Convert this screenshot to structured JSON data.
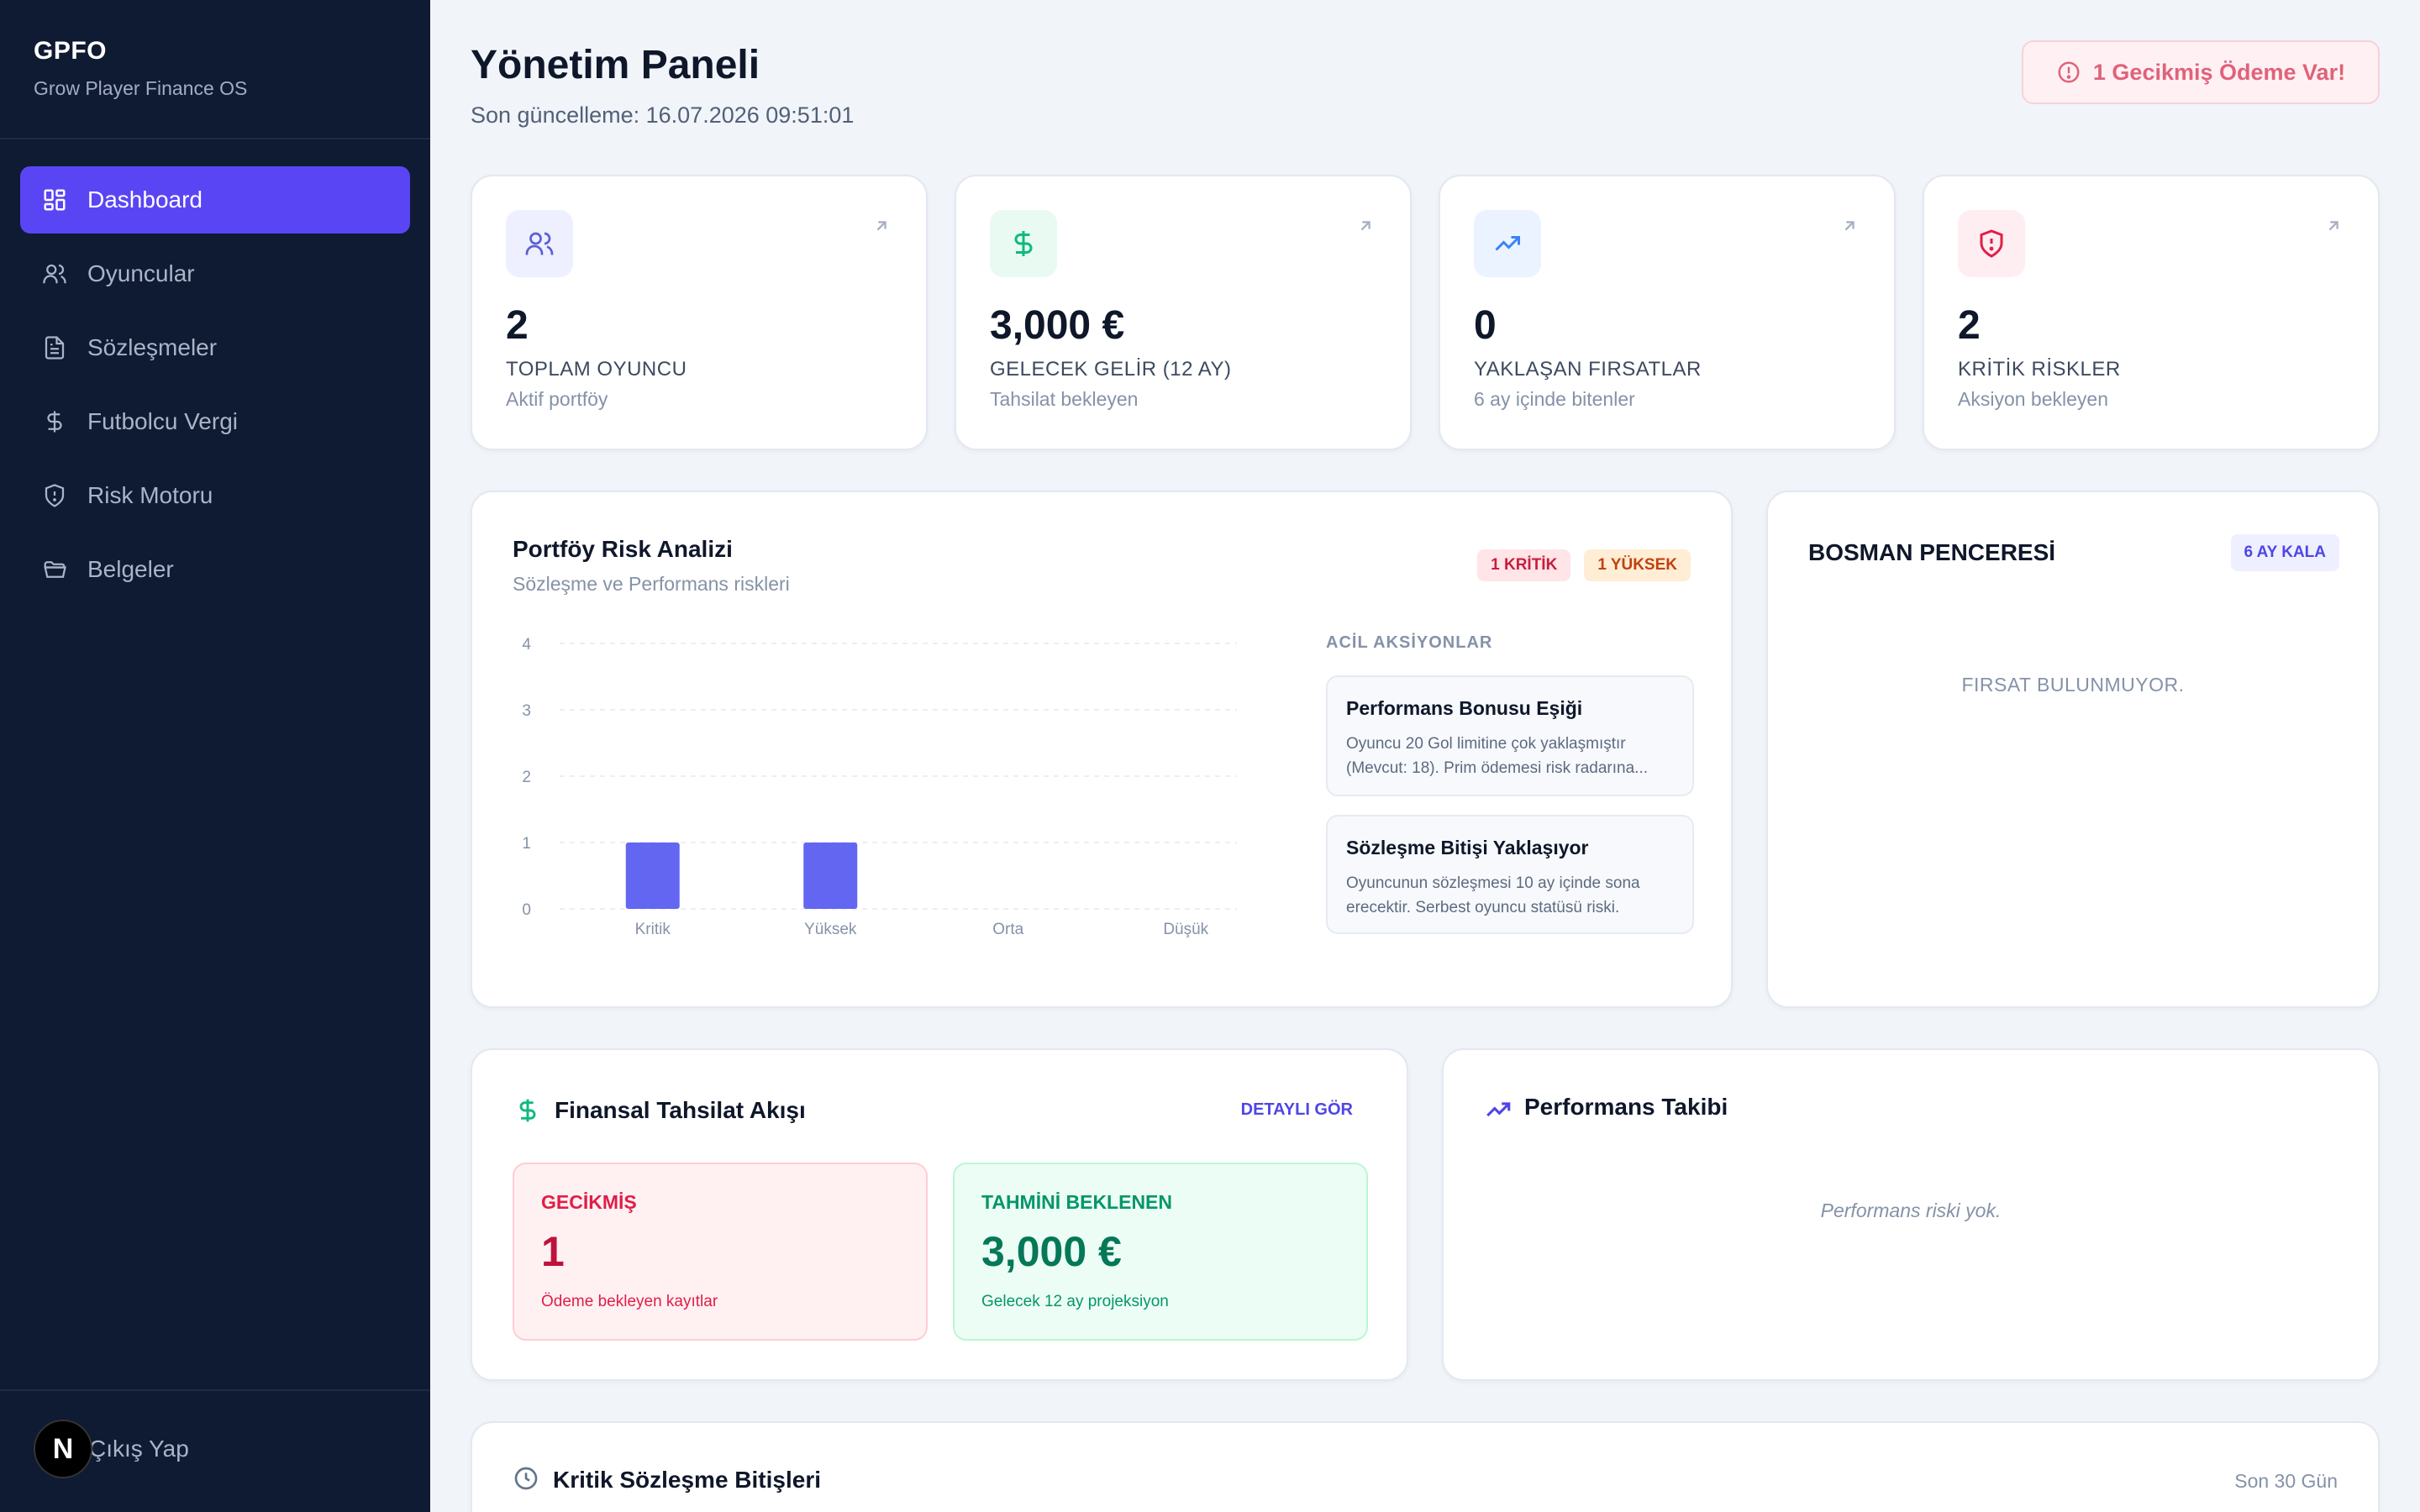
{
  "sidebar": {
    "brand_title": "GPFO",
    "brand_subtitle": "Grow Player Finance OS",
    "items": [
      {
        "label": "Dashboard",
        "icon": "dashboard-grid-icon",
        "active": true
      },
      {
        "label": "Oyuncular",
        "icon": "users-icon"
      },
      {
        "label": "Sözleşmeler",
        "icon": "document-icon"
      },
      {
        "label": "Futbolcu Vergi",
        "icon": "dollar-icon"
      },
      {
        "label": "Risk Motoru",
        "icon": "shield-icon"
      },
      {
        "label": "Belgeler",
        "icon": "folder-icon"
      }
    ],
    "avatar_letter": "N",
    "logout_label": "Çıkış Yap"
  },
  "header": {
    "title": "Yönetim Paneli",
    "last_updated": "Son güncelleme: 16.07.2026 09:51:01",
    "alert": "1 Gecikmiş Ödeme Var!"
  },
  "stats": [
    {
      "value": "2",
      "label": "TOPLAM OYUNCU",
      "sub": "Aktif portföy",
      "icon": "users-icon",
      "color": "#5b5fd6"
    },
    {
      "value": "3,000 €",
      "label": "GELECEK GELİR (12 AY)",
      "sub": "Tahsilat bekleyen",
      "icon": "dollar-icon",
      "color": "#10b981"
    },
    {
      "value": "0",
      "label": "YAKLAŞAN FIRSATLAR",
      "sub": "6 ay içinde bitenler",
      "icon": "trending-up-icon",
      "color": "#3b82f6"
    },
    {
      "value": "2",
      "label": "KRİTİK RİSKLER",
      "sub": "Aksiyon bekleyen",
      "icon": "shield-alert-icon",
      "color": "#e11d48"
    }
  ],
  "risk": {
    "title": "Portföy Risk Analizi",
    "subtitle": "Sözleşme ve Performans riskleri",
    "badge_critical": "1 KRİTİK",
    "badge_high": "1 YÜKSEK",
    "actions_heading": "ACİL AKSİYONLAR",
    "actions": [
      {
        "title": "Performans Bonusu Eşiği",
        "text": "Oyuncu 20 Gol limitine çok yaklaşmıştır (Mevcut: 18). Prim ödemesi risk radarına..."
      },
      {
        "title": "Sözleşme Bitişi Yaklaşıyor",
        "text": "Oyuncunun sözleşmesi 10 ay içinde sona erecektir. Serbest oyuncu statüsü riski."
      }
    ]
  },
  "chart_data": {
    "type": "bar",
    "categories": [
      "Kritik",
      "Yüksek",
      "Orta",
      "Düşük"
    ],
    "values": [
      1,
      1,
      0,
      0
    ],
    "ylim": [
      0,
      4
    ],
    "yticks": [
      "0",
      "1",
      "2",
      "3",
      "4"
    ],
    "grid": true,
    "color": "#6366f1"
  },
  "bosman": {
    "title": "BOSMAN PENCERESİ",
    "badge": "6 AY KALA",
    "empty": "FIRSAT BULUNMUYOR."
  },
  "finance": {
    "title": "Finansal Tahsilat Akışı",
    "link": "DETAYLI GÖR",
    "overdue": {
      "label": "GECİKMİŞ",
      "value": "1",
      "sub": "Ödeme bekleyen kayıtlar"
    },
    "expected": {
      "label": "TAHMİNİ BEKLENEN",
      "value": "3,000 €",
      "sub": "Gelecek 12 ay projeksiyon"
    }
  },
  "performance": {
    "title": "Performans Takibi",
    "empty": "Performans riski yok."
  },
  "contracts": {
    "title": "Kritik Sözleşme Bitişleri",
    "range": "Son 30 Gün"
  }
}
